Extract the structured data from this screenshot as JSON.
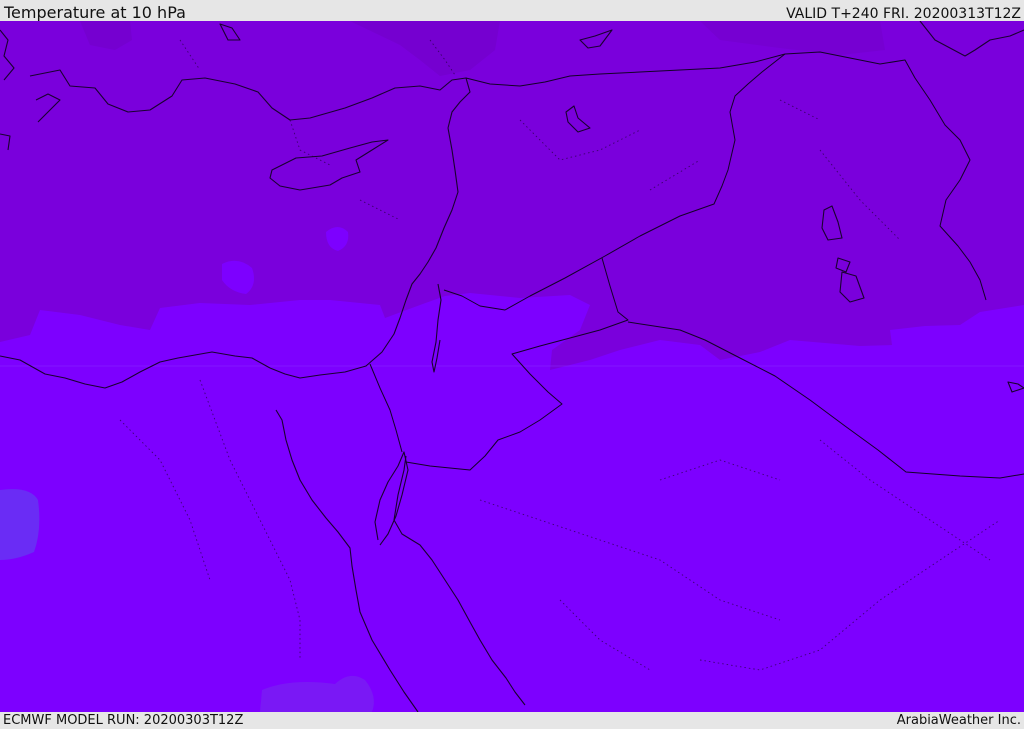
{
  "header": {
    "title": "Temperature at 10 hPa",
    "valid": "VALID T+240 FRI. 20200313T12Z"
  },
  "footer": {
    "model_run": "ECMWF MODEL RUN: 20200303T12Z",
    "credit": "ArabiaWeather Inc."
  },
  "map": {
    "colors": {
      "warm_band": "#7a00dc",
      "cool_band": "#7d00ff",
      "cool_patch": "#6a2cf5",
      "coastline": "#1a0030",
      "border": "#140028"
    }
  }
}
